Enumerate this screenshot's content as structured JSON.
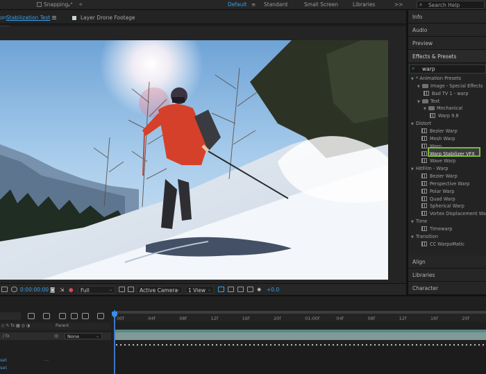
{
  "workspace_bar": {
    "snapping_label": "Snapping",
    "workspaces": [
      "Default",
      "Standard",
      "Small Screen",
      "Libraries"
    ],
    "active_workspace": "Default",
    "menu_icon": ">>",
    "search_placeholder": "Search Help"
  },
  "composition_panel": {
    "comp_tab_prefix": "on",
    "comp_tab_name": "Stabilization Test",
    "layer_tab_label": "Layer Drone Footage"
  },
  "viewer_controls": {
    "timecode": "0:00:00:00",
    "resolution": "Full",
    "camera": "Active Camera",
    "views": "1 View",
    "exposure": "+0.0"
  },
  "right_panel": {
    "panels_top": [
      "Info",
      "Audio",
      "Preview",
      "Effects & Presets"
    ],
    "search_value": "warp",
    "tree": [
      {
        "level": 0,
        "type": "folder",
        "label": "* Animation Presets",
        "open": true
      },
      {
        "level": 1,
        "type": "folder",
        "label": "Image - Special Effects",
        "open": true
      },
      {
        "level": 2,
        "type": "preset",
        "label": "Bad TV 1 - warp"
      },
      {
        "level": 1,
        "type": "folder",
        "label": "Text",
        "open": true
      },
      {
        "level": 2,
        "type": "folder",
        "label": "Mechanical",
        "open": true
      },
      {
        "level": 3,
        "type": "preset",
        "label": "Warp 9.8"
      },
      {
        "level": 0,
        "type": "category",
        "label": "Distort",
        "open": true
      },
      {
        "level": 1,
        "type": "effect",
        "label": "Bezier Warp"
      },
      {
        "level": 1,
        "type": "effect",
        "label": "Mesh Warp"
      },
      {
        "level": 1,
        "type": "effect",
        "label": "Warp"
      },
      {
        "level": 1,
        "type": "effect",
        "label": "Warp Stabilizer VFX",
        "highlighted": true
      },
      {
        "level": 1,
        "type": "effect",
        "label": "Wave Warp"
      },
      {
        "level": 0,
        "type": "category",
        "label": "HitFilm - Warp",
        "open": true
      },
      {
        "level": 1,
        "type": "effect",
        "label": "Bezier Warp"
      },
      {
        "level": 1,
        "type": "effect",
        "label": "Perspective Warp"
      },
      {
        "level": 1,
        "type": "effect",
        "label": "Polar Warp"
      },
      {
        "level": 1,
        "type": "effect",
        "label": "Quad Warp"
      },
      {
        "level": 1,
        "type": "effect",
        "label": "Spherical Warp"
      },
      {
        "level": 1,
        "type": "effect",
        "label": "Vortex Displacement Warp"
      },
      {
        "level": 0,
        "type": "category",
        "label": "Time",
        "open": true
      },
      {
        "level": 1,
        "type": "effect",
        "label": "Timewarp"
      },
      {
        "level": 0,
        "type": "category",
        "label": "Transition",
        "open": true
      },
      {
        "level": 1,
        "type": "effect",
        "label": "CC WarpoMatic"
      }
    ],
    "panels_bottom": [
      "Align",
      "Libraries",
      "Character"
    ]
  },
  "timeline": {
    "ruler_ticks": [
      "00f",
      "04f",
      "08f",
      "12f",
      "16f",
      "20f",
      "01:00f",
      "04f",
      "08f",
      "12f",
      "16f",
      "20f"
    ],
    "parent_header": "Parent",
    "parent_value": "None",
    "left_labels": [
      "set",
      "set"
    ],
    "ellipsis": "..."
  },
  "colors": {
    "accent": "#3aa0e8",
    "highlight": "#7db83c",
    "layer_bar": "#7f9a97"
  }
}
